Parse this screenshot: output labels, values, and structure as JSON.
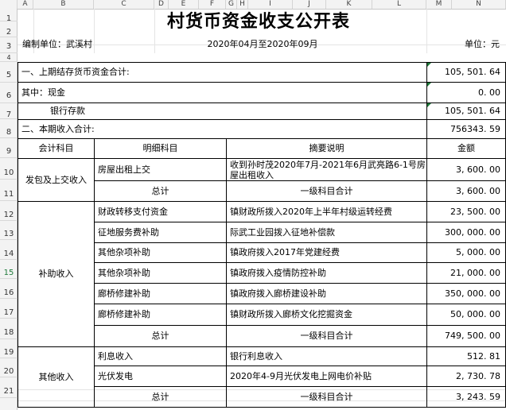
{
  "columns": [
    "A",
    "B",
    "C",
    "D",
    "E",
    "F",
    "G",
    "H",
    "I",
    "J",
    "K",
    "L",
    "M",
    "N"
  ],
  "rows": [
    "1",
    "2",
    "3",
    "4",
    "5",
    "6",
    "7",
    "8",
    "9",
    "10",
    "11",
    "12",
    "13",
    "14",
    "15",
    "16",
    "17",
    "18",
    "19",
    "20",
    "21"
  ],
  "title": "村货币资金收支公开表",
  "unit_label": "编制单位：武溪村",
  "period": "2020年04月至2020年09月",
  "currency_unit": "单位：元",
  "prior_balance": {
    "label": "一、上期结存货币资金合计:",
    "value": "105, 501. 64"
  },
  "cash": {
    "label": "其中：现金",
    "value": "0. 00"
  },
  "bank": {
    "label": "银行存款",
    "value": "105, 501. 64"
  },
  "income_total": {
    "label": "二、本期收入合计:",
    "value": "756343. 59"
  },
  "headers": {
    "subject": "会计科目",
    "detail": "明细科目",
    "summary": "摘要说明",
    "amount": "金额"
  },
  "groups": [
    {
      "name": "发包及上交收入",
      "items": [
        {
          "detail": "房屋出租上交",
          "summary": "收到孙时茂2020年7月-2021年6月武亮路6-1号房屋出租收入",
          "amount": "3, 600. 00"
        }
      ],
      "total": {
        "label": "总计",
        "summary": "一级科目合计",
        "amount": "3, 600. 00"
      }
    },
    {
      "name": "补助收入",
      "items": [
        {
          "detail": "财政转移支付资金",
          "summary": "镇财政所拨入2020年上半年村级运转经费",
          "amount": "23, 500. 00"
        },
        {
          "detail": "征地服务费补助",
          "summary": "际武工业园拨入征地补偿款",
          "amount": "300, 000. 00"
        },
        {
          "detail": "其他杂项补助",
          "summary": "镇政府拨入2017年党建经费",
          "amount": "5, 000. 00"
        },
        {
          "detail": "其他杂项补助",
          "summary": "镇政府拨入疫情防控补助",
          "amount": "21, 000. 00"
        },
        {
          "detail": "廊桥修建补助",
          "summary": "镇政府拨入廊桥建设补助",
          "amount": "350, 000. 00"
        },
        {
          "detail": "廊桥修建补助",
          "summary": "镇财政所拨入廊桥文化挖掘资金",
          "amount": "50, 000. 00"
        }
      ],
      "total": {
        "label": "总计",
        "summary": "一级科目合计",
        "amount": "749, 500. 00"
      }
    },
    {
      "name": "其他收入",
      "items": [
        {
          "detail": "利息收入",
          "summary": "银行利息收入",
          "amount": "512. 81"
        },
        {
          "detail": "光伏发电",
          "summary": "2020年4-9月光伏发电上网电价补贴",
          "amount": "2, 730. 78"
        }
      ],
      "total": {
        "label": "总计",
        "summary": "一级科目合计",
        "amount": "3, 243. 59"
      }
    }
  ]
}
